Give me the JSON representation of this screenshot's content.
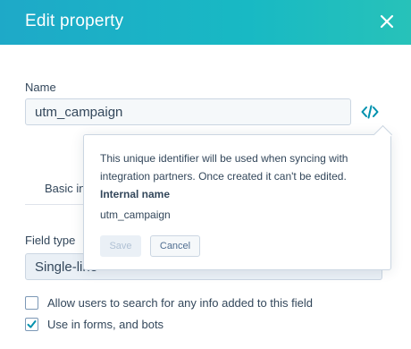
{
  "header": {
    "title": "Edit property"
  },
  "name_field": {
    "label": "Name",
    "value": "utm_campaign"
  },
  "tabs": {
    "basic_info_visible": "Basic info"
  },
  "field_type": {
    "label": "Field type",
    "value_visible": "Single-line"
  },
  "checkboxes": [
    {
      "label": "Allow users to search for any info added to this field",
      "checked": false
    },
    {
      "label": "Use in forms, and bots",
      "checked": true
    }
  ],
  "popover": {
    "line1": "This unique identifier will be used when syncing with",
    "line2": "integration partners. Once created it can't be edited.",
    "internal_name_label": "Internal name",
    "internal_name_value": "utm_campaign",
    "save_label": "Save",
    "cancel_label": "Cancel"
  },
  "colors": {
    "header_gradient_start": "#1ea9c8",
    "header_gradient_end": "#27c2b9",
    "text": "#33475b",
    "accent": "#0091ae"
  },
  "icons": {
    "close": "close-icon",
    "code": "code-icon",
    "check": "checkmark-icon"
  }
}
